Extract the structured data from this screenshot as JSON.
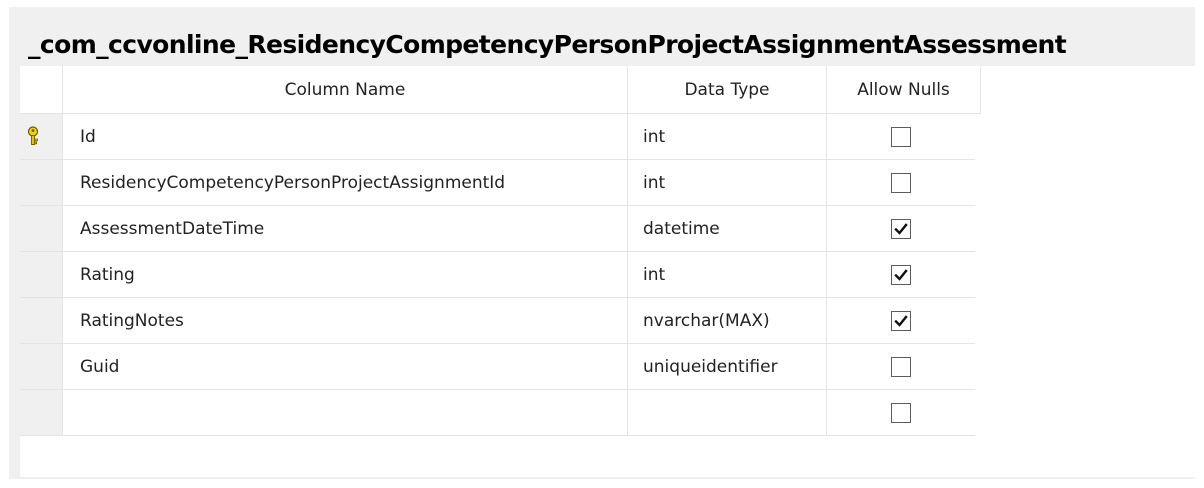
{
  "table": {
    "title": "_com_ccvonline_ResidencyCompetencyPersonProjectAssignmentAssessment",
    "headers": {
      "column_name": "Column Name",
      "data_type": "Data Type",
      "allow_nulls": "Allow Nulls"
    },
    "rows": [
      {
        "name": "Id",
        "type": "int",
        "allow_nulls": false,
        "primary_key": true
      },
      {
        "name": "ResidencyCompetencyPersonProjectAssignmentId",
        "type": "int",
        "allow_nulls": false,
        "primary_key": false
      },
      {
        "name": "AssessmentDateTime",
        "type": "datetime",
        "allow_nulls": true,
        "primary_key": false
      },
      {
        "name": "Rating",
        "type": "int",
        "allow_nulls": true,
        "primary_key": false
      },
      {
        "name": "RatingNotes",
        "type": "nvarchar(MAX)",
        "allow_nulls": true,
        "primary_key": false
      },
      {
        "name": "Guid",
        "type": "uniqueidentifier",
        "allow_nulls": false,
        "primary_key": false
      },
      {
        "name": "",
        "type": "",
        "allow_nulls": false,
        "primary_key": false
      }
    ]
  },
  "icons": {
    "primary_key": "key-icon",
    "checked": "checkmark-icon"
  }
}
